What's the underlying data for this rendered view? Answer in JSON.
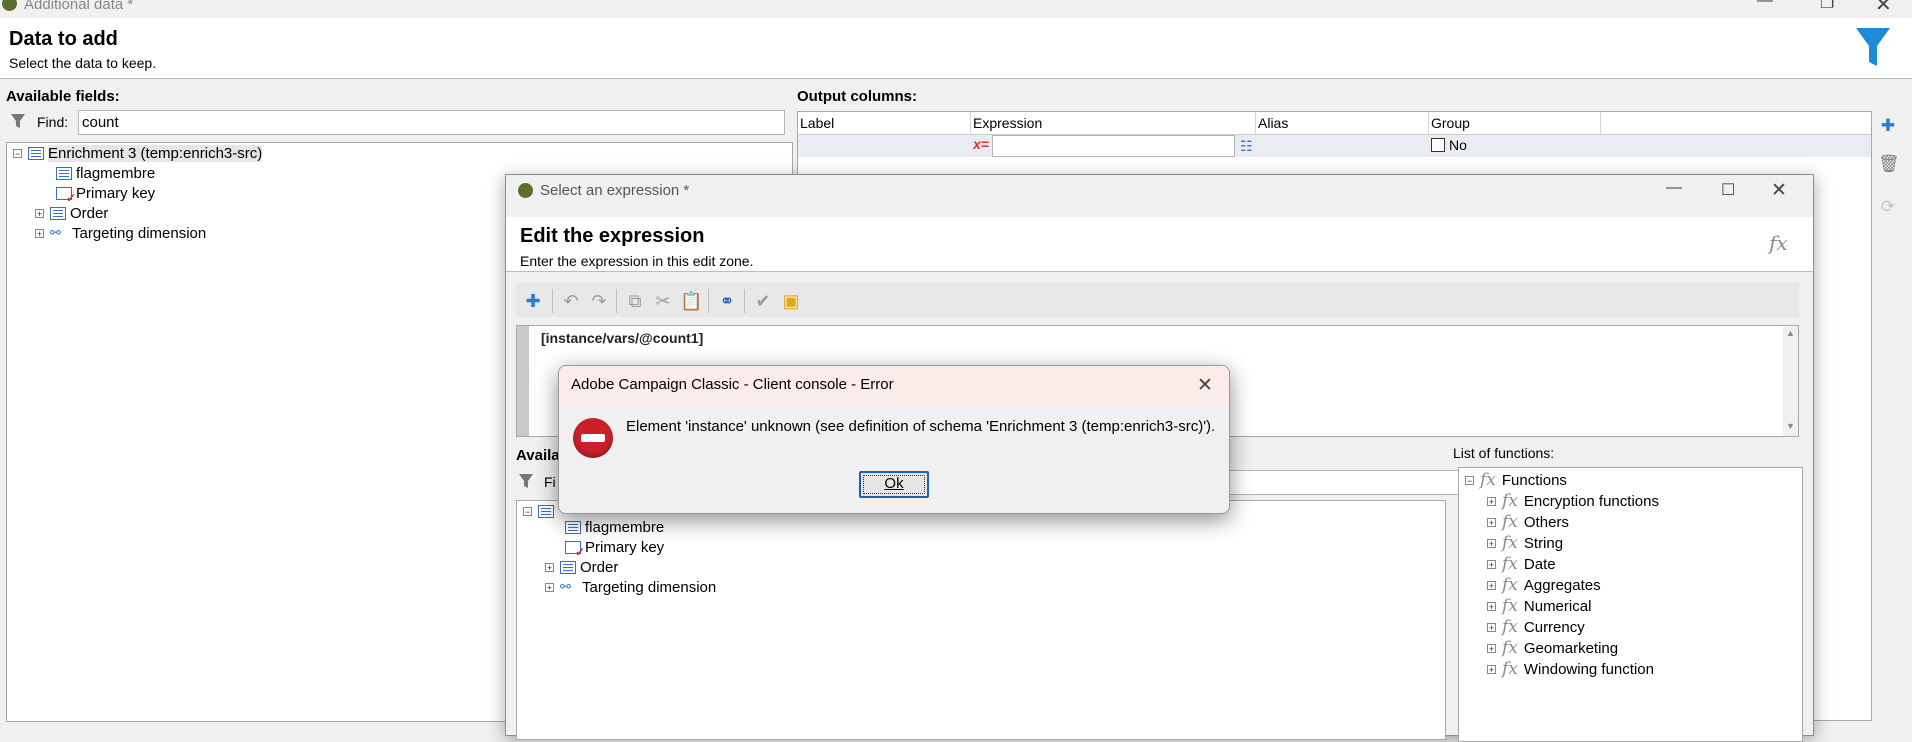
{
  "window": {
    "title": "Additional data *"
  },
  "header": {
    "title": "Data to add",
    "subtitle": "Select the data to keep."
  },
  "available_fields": {
    "label": "Available fields:",
    "find_label": "Find:",
    "find_value": "count",
    "tree": {
      "root": "Enrichment 3 (temp:enrich3-src)",
      "items": [
        "flagmembre",
        "Primary key",
        "Order",
        "Targeting dimension"
      ]
    }
  },
  "output_columns": {
    "label": "Output columns:",
    "headers": [
      "Label",
      "Expression",
      "Alias",
      "Group"
    ],
    "row": {
      "expression_marker": "x=",
      "group_value": "No"
    }
  },
  "expr_dialog": {
    "title": "Select an expression *",
    "header_title": "Edit the expression",
    "header_subtitle": "Enter the expression in this edit zone.",
    "fx_label": "fx",
    "expression": "[instance/vars/@count1]",
    "available_label": "Availa",
    "find_label_partial": "Fi",
    "tree_items": [
      "flagmembre",
      "Primary key",
      "Order",
      "Targeting dimension"
    ],
    "functions_label": "List of functions:",
    "functions_root": "Functions",
    "functions": [
      "Encryption functions",
      "Others",
      "String",
      "Date",
      "Aggregates",
      "Numerical",
      "Currency",
      "Geomarketing",
      "Windowing function"
    ]
  },
  "error_dialog": {
    "title": "Adobe Campaign Classic - Client console - Error",
    "message": "Element 'instance' unknown (see definition of schema 'Enrichment 3 (temp:enrich3-src)').",
    "ok_label": "Ok"
  },
  "colors": {
    "accent_blue": "#1d8bd6",
    "error_red": "#c9202a",
    "error_titlebar": "#f9ece9"
  }
}
